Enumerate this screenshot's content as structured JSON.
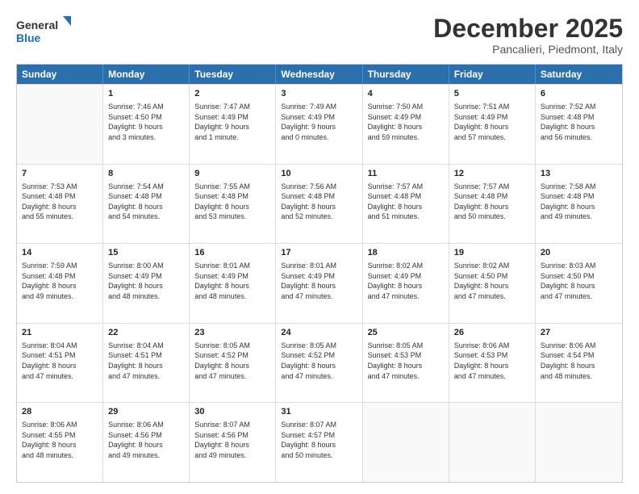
{
  "header": {
    "logo_line1": "General",
    "logo_line2": "Blue",
    "month": "December 2025",
    "location": "Pancalieri, Piedmont, Italy"
  },
  "days_of_week": [
    "Sunday",
    "Monday",
    "Tuesday",
    "Wednesday",
    "Thursday",
    "Friday",
    "Saturday"
  ],
  "rows": [
    [
      {
        "day": "",
        "info": ""
      },
      {
        "day": "1",
        "info": "Sunrise: 7:46 AM\nSunset: 4:50 PM\nDaylight: 9 hours\nand 3 minutes."
      },
      {
        "day": "2",
        "info": "Sunrise: 7:47 AM\nSunset: 4:49 PM\nDaylight: 9 hours\nand 1 minute."
      },
      {
        "day": "3",
        "info": "Sunrise: 7:49 AM\nSunset: 4:49 PM\nDaylight: 9 hours\nand 0 minutes."
      },
      {
        "day": "4",
        "info": "Sunrise: 7:50 AM\nSunset: 4:49 PM\nDaylight: 8 hours\nand 59 minutes."
      },
      {
        "day": "5",
        "info": "Sunrise: 7:51 AM\nSunset: 4:49 PM\nDaylight: 8 hours\nand 57 minutes."
      },
      {
        "day": "6",
        "info": "Sunrise: 7:52 AM\nSunset: 4:48 PM\nDaylight: 8 hours\nand 56 minutes."
      }
    ],
    [
      {
        "day": "7",
        "info": "Sunrise: 7:53 AM\nSunset: 4:48 PM\nDaylight: 8 hours\nand 55 minutes."
      },
      {
        "day": "8",
        "info": "Sunrise: 7:54 AM\nSunset: 4:48 PM\nDaylight: 8 hours\nand 54 minutes."
      },
      {
        "day": "9",
        "info": "Sunrise: 7:55 AM\nSunset: 4:48 PM\nDaylight: 8 hours\nand 53 minutes."
      },
      {
        "day": "10",
        "info": "Sunrise: 7:56 AM\nSunset: 4:48 PM\nDaylight: 8 hours\nand 52 minutes."
      },
      {
        "day": "11",
        "info": "Sunrise: 7:57 AM\nSunset: 4:48 PM\nDaylight: 8 hours\nand 51 minutes."
      },
      {
        "day": "12",
        "info": "Sunrise: 7:57 AM\nSunset: 4:48 PM\nDaylight: 8 hours\nand 50 minutes."
      },
      {
        "day": "13",
        "info": "Sunrise: 7:58 AM\nSunset: 4:48 PM\nDaylight: 8 hours\nand 49 minutes."
      }
    ],
    [
      {
        "day": "14",
        "info": "Sunrise: 7:59 AM\nSunset: 4:48 PM\nDaylight: 8 hours\nand 49 minutes."
      },
      {
        "day": "15",
        "info": "Sunrise: 8:00 AM\nSunset: 4:49 PM\nDaylight: 8 hours\nand 48 minutes."
      },
      {
        "day": "16",
        "info": "Sunrise: 8:01 AM\nSunset: 4:49 PM\nDaylight: 8 hours\nand 48 minutes."
      },
      {
        "day": "17",
        "info": "Sunrise: 8:01 AM\nSunset: 4:49 PM\nDaylight: 8 hours\nand 47 minutes."
      },
      {
        "day": "18",
        "info": "Sunrise: 8:02 AM\nSunset: 4:49 PM\nDaylight: 8 hours\nand 47 minutes."
      },
      {
        "day": "19",
        "info": "Sunrise: 8:02 AM\nSunset: 4:50 PM\nDaylight: 8 hours\nand 47 minutes."
      },
      {
        "day": "20",
        "info": "Sunrise: 8:03 AM\nSunset: 4:50 PM\nDaylight: 8 hours\nand 47 minutes."
      }
    ],
    [
      {
        "day": "21",
        "info": "Sunrise: 8:04 AM\nSunset: 4:51 PM\nDaylight: 8 hours\nand 47 minutes."
      },
      {
        "day": "22",
        "info": "Sunrise: 8:04 AM\nSunset: 4:51 PM\nDaylight: 8 hours\nand 47 minutes."
      },
      {
        "day": "23",
        "info": "Sunrise: 8:05 AM\nSunset: 4:52 PM\nDaylight: 8 hours\nand 47 minutes."
      },
      {
        "day": "24",
        "info": "Sunrise: 8:05 AM\nSunset: 4:52 PM\nDaylight: 8 hours\nand 47 minutes."
      },
      {
        "day": "25",
        "info": "Sunrise: 8:05 AM\nSunset: 4:53 PM\nDaylight: 8 hours\nand 47 minutes."
      },
      {
        "day": "26",
        "info": "Sunrise: 8:06 AM\nSunset: 4:53 PM\nDaylight: 8 hours\nand 47 minutes."
      },
      {
        "day": "27",
        "info": "Sunrise: 8:06 AM\nSunset: 4:54 PM\nDaylight: 8 hours\nand 48 minutes."
      }
    ],
    [
      {
        "day": "28",
        "info": "Sunrise: 8:06 AM\nSunset: 4:55 PM\nDaylight: 8 hours\nand 48 minutes."
      },
      {
        "day": "29",
        "info": "Sunrise: 8:06 AM\nSunset: 4:56 PM\nDaylight: 8 hours\nand 49 minutes."
      },
      {
        "day": "30",
        "info": "Sunrise: 8:07 AM\nSunset: 4:56 PM\nDaylight: 8 hours\nand 49 minutes."
      },
      {
        "day": "31",
        "info": "Sunrise: 8:07 AM\nSunset: 4:57 PM\nDaylight: 8 hours\nand 50 minutes."
      },
      {
        "day": "",
        "info": ""
      },
      {
        "day": "",
        "info": ""
      },
      {
        "day": "",
        "info": ""
      }
    ]
  ]
}
